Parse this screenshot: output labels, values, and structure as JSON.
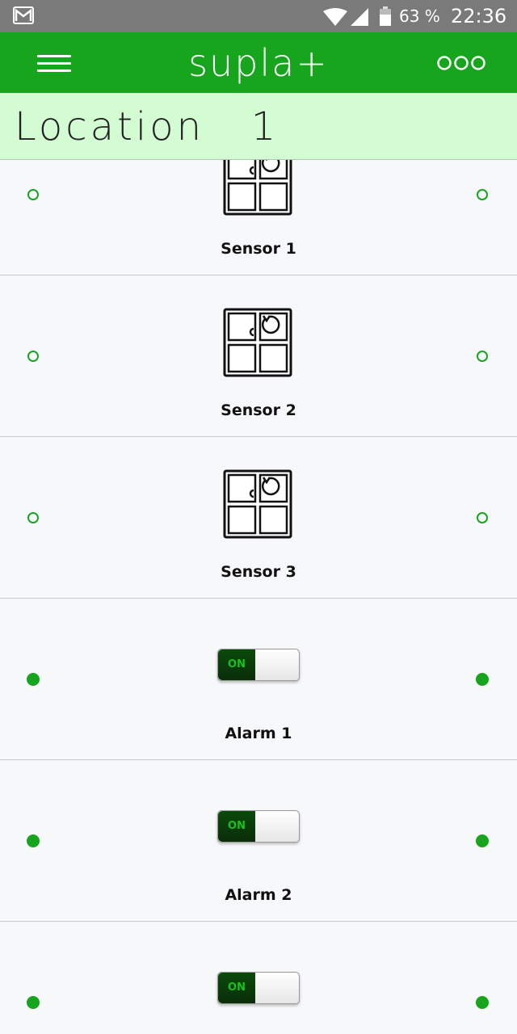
{
  "status_bar": {
    "battery_text": "63 %",
    "time": "22:36",
    "icons": [
      "gmail-icon",
      "wifi-icon",
      "signal-icon",
      "battery-icon"
    ]
  },
  "app_bar": {
    "logo": "supla+",
    "menu_icon": "hamburger-menu-icon",
    "more_icon": "three-circles-icon",
    "color": "#17a51d"
  },
  "location": {
    "title": "Location   1",
    "background": "#d4fcd2"
  },
  "channels": [
    {
      "type": "sensor",
      "label": "Sensor 1",
      "state": "off"
    },
    {
      "type": "sensor",
      "label": "Sensor 2",
      "state": "off"
    },
    {
      "type": "sensor",
      "label": "Sensor 3",
      "state": "off"
    },
    {
      "type": "alarm",
      "label": "Alarm 1",
      "state": "on",
      "switch_text": "ON"
    },
    {
      "type": "alarm",
      "label": "Alarm 2",
      "state": "on",
      "switch_text": "ON"
    },
    {
      "type": "alarm",
      "label": "",
      "state": "on",
      "switch_text": "ON"
    }
  ],
  "colors": {
    "accent": "#17a51d",
    "status_bar": "#7a7a7a",
    "row_background": "#f7f8fa"
  }
}
